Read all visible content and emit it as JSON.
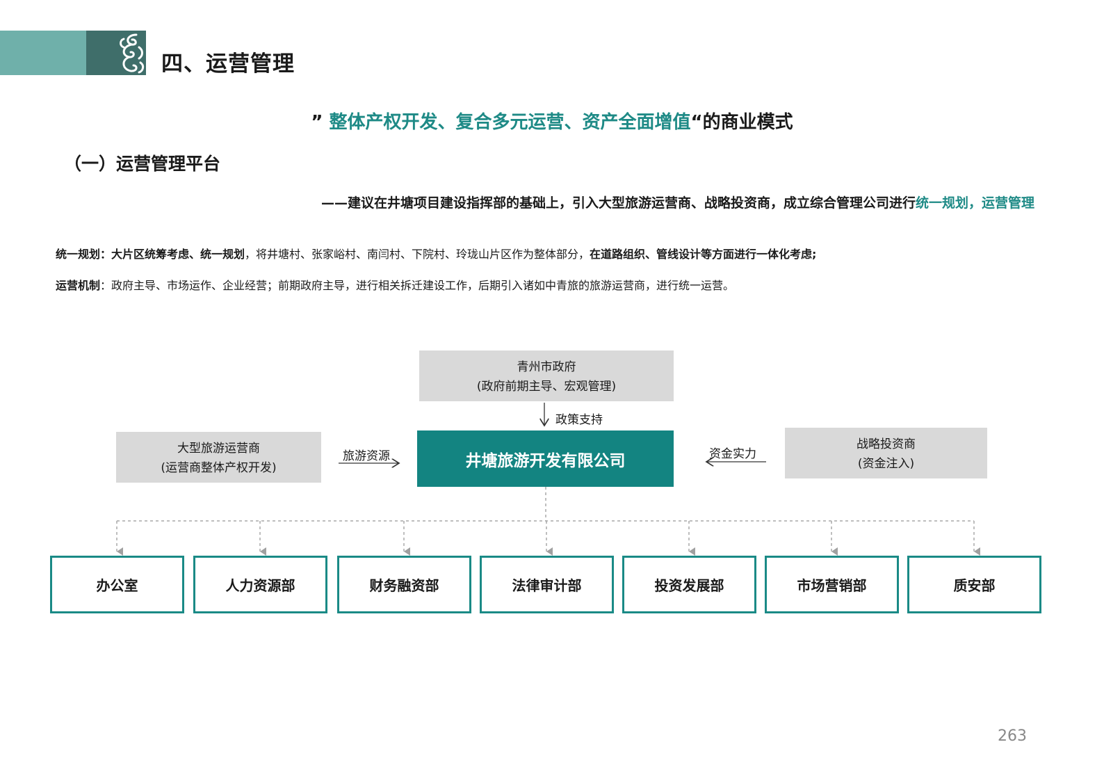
{
  "header": {
    "title": "四、运营管理",
    "band_colors": {
      "light": "#6fb0aa",
      "dark": "#3f6e6a"
    },
    "ornament_icon": "cloud-scroll-ornament"
  },
  "tagline": {
    "open_quote": "” ",
    "highlight": "整体产权开发、复合多元运营、资产全面增值",
    "rest": "“的商业模式"
  },
  "subsection_title": "（一）运营管理平台",
  "proposal": {
    "text": "——建议在井塘项目建设指挥部的基础上，引入大型旅游运营商、战略投资商，成立综合管理公司进行",
    "highlight": "统一规划，运营管理"
  },
  "paragraphs": {
    "planning": {
      "label": "统一规划：",
      "bold1": "大片区统筹考虑、统一规划",
      "text1": "，将井塘村、张家峪村、南闫村、下院村、玲珑山片区作为整体部分，",
      "bold2": "在道路组织、管线设计等方面进行一体化考虑;"
    },
    "mechanism": {
      "label": "运营机制",
      "text": "：政府主导、市场运作、企业经营；前期政府主导，进行相关拆迁建设工作，后期引入诸如中青旅的旅游运营商，进行统一运营。"
    }
  },
  "diagram": {
    "government": {
      "line1": "青州市政府",
      "line2": "(政府前期主导、宏观管理)"
    },
    "operator": {
      "line1": "大型旅游运营商",
      "line2": "(运营商整体产权开发)"
    },
    "investor": {
      "line1": "战略投资商",
      "line2": "(资金注入)"
    },
    "company": "井塘旅游开发有限公司",
    "edges": {
      "policy": "政策支持",
      "tourism": "旅游资源",
      "capital": "资金实力"
    },
    "departments": [
      "办公室",
      "人力资源部",
      "财务融资部",
      "法律审计部",
      "投资发展部",
      "市场营销部",
      "质安部"
    ],
    "colors": {
      "company": "#138481",
      "box": "#d9d9d9",
      "dept_border": "#1a8a86",
      "accent_text": "#1e8a86"
    }
  },
  "page_number": "263"
}
